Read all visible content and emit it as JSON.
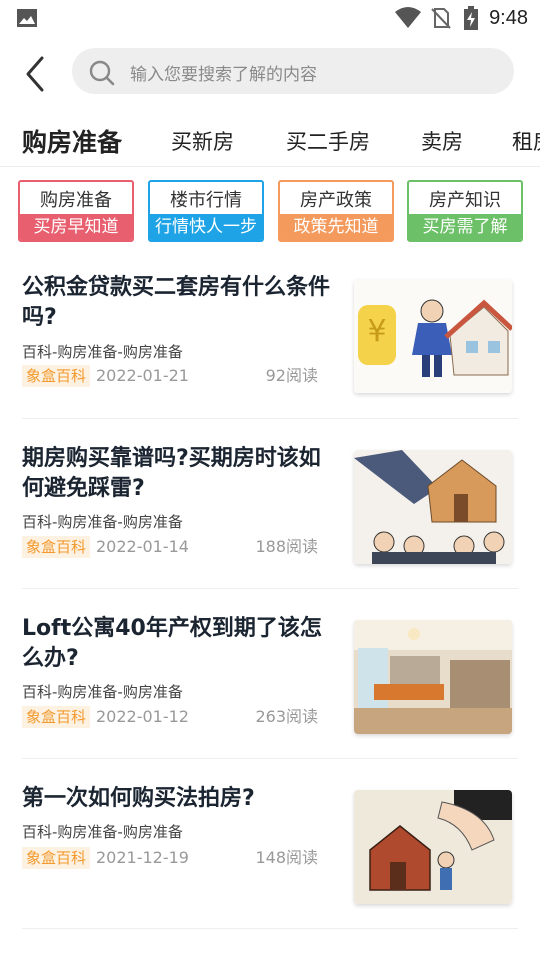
{
  "status_bar": {
    "time": "9:48",
    "icons": [
      "image-icon",
      "wifi-icon",
      "no-sim-icon",
      "battery-charging-icon"
    ]
  },
  "search": {
    "placeholder": "输入您要搜索了解的内容"
  },
  "tabs": [
    {
      "label": "购房准备",
      "active": true
    },
    {
      "label": "买新房",
      "active": false
    },
    {
      "label": "买二手房",
      "active": false
    },
    {
      "label": "卖房",
      "active": false
    },
    {
      "label": "租房",
      "active": false
    }
  ],
  "categories": [
    {
      "title": "购房准备",
      "subtitle": "买房早知道",
      "color": "#e8606f"
    },
    {
      "title": "楼市行情",
      "subtitle": "行情快人一步",
      "color": "#1ea4e6"
    },
    {
      "title": "房产政策",
      "subtitle": "政策先知道",
      "color": "#f49a5c"
    },
    {
      "title": "房产知识",
      "subtitle": "买房需了解",
      "color": "#6cc067"
    }
  ],
  "articles": [
    {
      "title": "公积金贷款买二套房有什么条件吗?",
      "category": "百科-购房准备-购房准备",
      "source": "象盒百科",
      "date": "2022-01-21",
      "reads": "92阅读",
      "image": "housing-fund-cartoon"
    },
    {
      "title": "期房购买靠谱吗?买期房时该如何避免踩雷?",
      "category": "百科-购房准备-购房准备",
      "source": "象盒百科",
      "date": "2022-01-14",
      "reads": "188阅读",
      "image": "hand-house-crowd-cartoon"
    },
    {
      "title": "Loft公寓40年产权到期了该怎么办?",
      "category": "百科-购房准备-购房准备",
      "source": "象盒百科",
      "date": "2022-01-12",
      "reads": "263阅读",
      "image": "living-room-photo"
    },
    {
      "title": "第一次如何购买法拍房?",
      "category": "百科-购房准备-购房准备",
      "source": "象盒百科",
      "date": "2021-12-19",
      "reads": "148阅读",
      "image": "auction-house-cartoon"
    }
  ],
  "colors": {
    "source_tag_text": "#f29a2e",
    "source_tag_bg": "#fdf1e2",
    "title_text": "#1b2431"
  }
}
